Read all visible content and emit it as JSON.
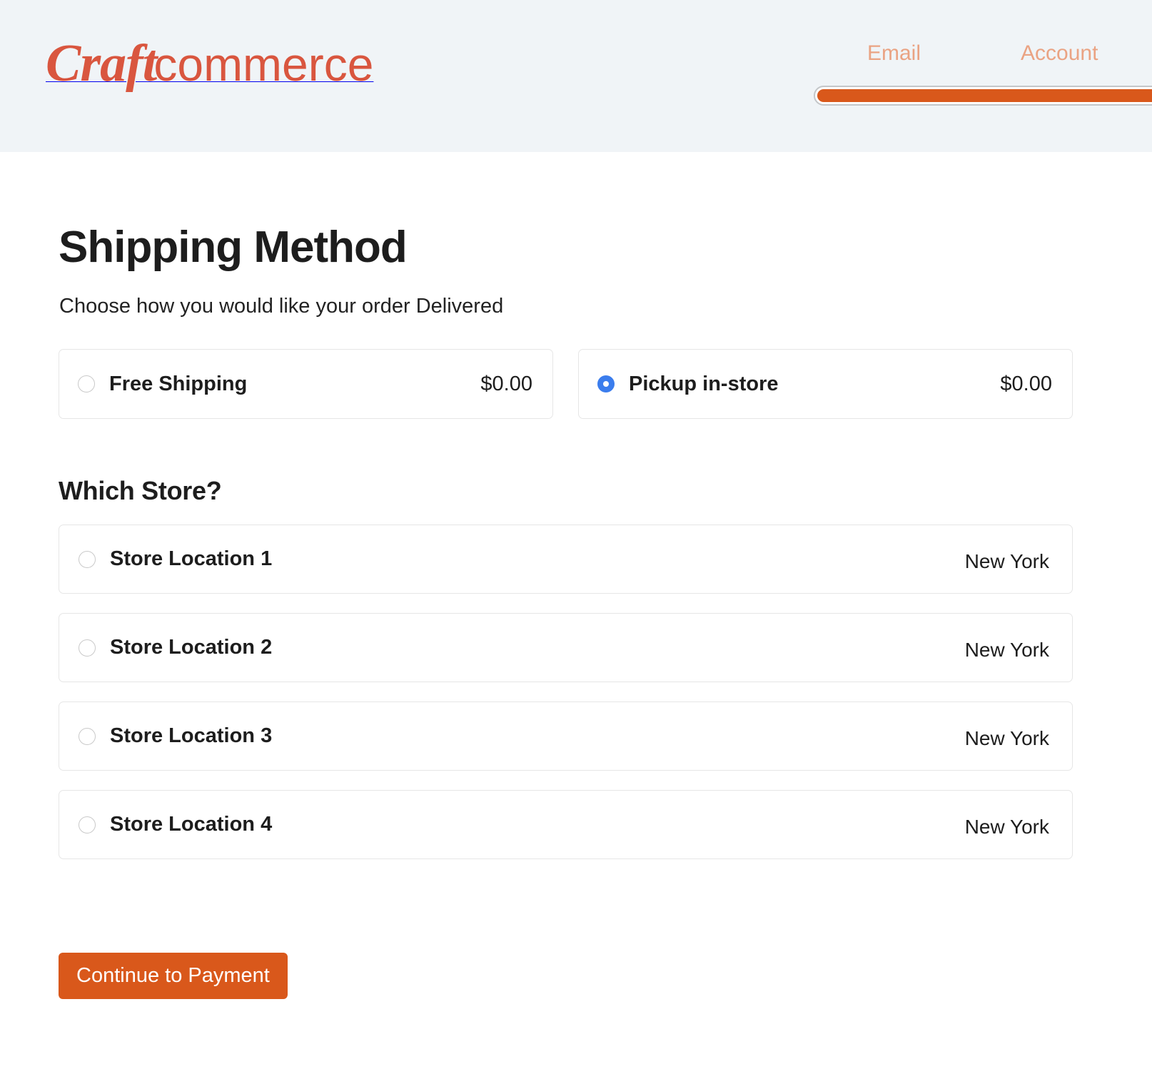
{
  "brand": {
    "name_bold": "Craft",
    "name_light": "commerce",
    "color": "#d9563f"
  },
  "header": {
    "nav": [
      {
        "label": "Email"
      },
      {
        "label": "Account"
      }
    ],
    "progress": {
      "percent": 100,
      "fill_color": "#d9581b",
      "track_color": "#ffffff"
    }
  },
  "page": {
    "title": "Shipping Method",
    "subtitle": "Choose how you would like your order Delivered"
  },
  "shipping_methods": {
    "options": [
      {
        "label": "Free Shipping",
        "price": "$0.00",
        "selected": false
      },
      {
        "label": "Pickup in-store",
        "price": "$0.00",
        "selected": true
      }
    ],
    "selected_color": "#3b7ded"
  },
  "stores": {
    "heading": "Which Store?",
    "items": [
      {
        "label": "Store Location 1",
        "region": "New York",
        "selected": false
      },
      {
        "label": "Store Location 2",
        "region": "New York",
        "selected": false
      },
      {
        "label": "Store Location 3",
        "region": "New York",
        "selected": false
      },
      {
        "label": "Store Location 4",
        "region": "New York",
        "selected": false
      }
    ]
  },
  "footer": {
    "submit_label": "Continue to Payment",
    "submit_color": "#d9581b"
  }
}
